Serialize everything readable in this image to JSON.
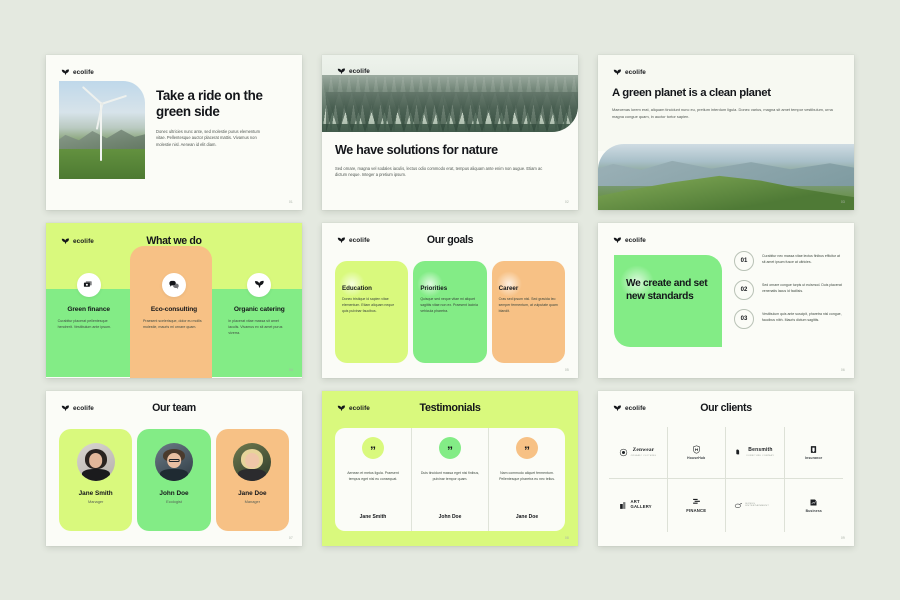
{
  "brand": {
    "name": "ecolife",
    "logo_icon": "leaf-sprout-icon"
  },
  "colors": {
    "background": "#e4e9e0",
    "slide_bg": "#fbfcf7",
    "lime": "#d9f97d",
    "green": "#83ec86",
    "orange": "#f7c185",
    "ink": "#14161a"
  },
  "slides": [
    {
      "id": "take-a-ride",
      "title": "Take a ride on the green side",
      "body": "Donec ultricies nunc ante, sed molestie purus elementum vitae. Pellentesque auctor placerat mattis. Vivamus non molestie nisl. Aenean id elit diam.",
      "image": "wind-turbine-photo",
      "page": "01"
    },
    {
      "id": "solutions-for-nature",
      "title": "We have solutions for nature",
      "body": "Sed ornare, magna vel sodales iaculis, lectus odio commodo erat, tempus aliquam ante enim non augue. Etiam ac dictum neque. Integer a pretium ipsum.",
      "image": "misty-forest-photo",
      "page": "02"
    },
    {
      "id": "green-planet",
      "title": "A green planet is a clean planet",
      "body": "Maecenas lorem erat, aliquam tincidunt nunc eu, pretium interdum ligula. Donec varius, magna sit amet tempor vestibulum, urna magna congue quam, in auctor tortor sapien.",
      "image": "mountain-range-photo",
      "page": "03"
    }
  ],
  "what_we_do": {
    "title": "What we do",
    "page": "04",
    "columns": [
      {
        "icon": "money-stack-icon",
        "heading": "Green finance",
        "body": "Curabitur placerat pellentesque hendrerit. Vestibulum ante ipsum."
      },
      {
        "icon": "chat-bubbles-icon",
        "heading": "Eco-consulting",
        "body": "Praesent scelerisque, dolor eu mollis molestie, mauris mi ornare quam."
      },
      {
        "icon": "sprout-icon",
        "heading": "Organic catering",
        "body": "In placerat vitae massa sit amet iaculis. Vivamus ex sit amet purus viverra."
      }
    ]
  },
  "our_goals": {
    "title": "Our goals",
    "page": "05",
    "cards": [
      {
        "heading": "Education",
        "color": "#d9f97d",
        "body": "Donec tristique id sapien vitae elementum. Etiam aliquam neque quis pulvinar faucibus."
      },
      {
        "heading": "Priorities",
        "color": "#83ec86",
        "body": "Quisque sed neque vitae mi aliquet sagittis vitae non ex. Praesent lacinia vehicula pharetra."
      },
      {
        "heading": "Career",
        "color": "#f7c185",
        "body": "Cras sed ipsum nisl. Sed gravida leo semper fermentum, at vulputate quam blandit."
      }
    ]
  },
  "standards": {
    "title": "We create and set new standards",
    "page": "06",
    "items": [
      {
        "number": "01",
        "body": "Curabitur nec massa vitae lectus finibus efficitur at sit amet ipsum fusce at ultricies."
      },
      {
        "number": "02",
        "body": "Sed ornare congue turpis ut euismod. Duis placerat venenatis lacus id facilisis."
      },
      {
        "number": "03",
        "body": "Vestibulum quis ante suscipit, pharetra nisl congue, faucibus nibh. Mauris dictum sagittis."
      }
    ]
  },
  "our_team": {
    "title": "Our team",
    "page": "07",
    "members": [
      {
        "name": "Jane Smith",
        "role": "Manager",
        "color": "#d9f97d",
        "avatar": "woman-dark-hair-avatar"
      },
      {
        "name": "John Doe",
        "role": "Ecologist",
        "color": "#83ec86",
        "avatar": "man-glasses-avatar"
      },
      {
        "name": "Jane Doe",
        "role": "Manager",
        "color": "#f7c185",
        "avatar": "woman-blonde-avatar"
      }
    ]
  },
  "testimonials": {
    "title": "Testimonials",
    "page": "08",
    "quote_glyph": "”",
    "items": [
      {
        "badge_color": "#d9f97d",
        "quote": "Aenean et metus ligula. Praesent tempus eget nisl eu consequat.",
        "name": "Jane Smith"
      },
      {
        "badge_color": "#83ec86",
        "quote": "Duis tincidunt massa eget nisi finibus, pulvinar tempor quam.",
        "name": "John Doe"
      },
      {
        "badge_color": "#f7c185",
        "quote": "Nam commodo aliquet fermentum. Pellentesque pharetra eu nec tellus.",
        "name": "Jane Doe"
      }
    ]
  },
  "our_clients": {
    "title": "Our clients",
    "page": "09",
    "logos": [
      {
        "name": "Zenwear",
        "sub": "ORGANIC CLOTHING",
        "icon": "circle-emblem-icon",
        "style": "serif"
      },
      {
        "name": "HouseHub",
        "sub": "",
        "icon": "shield-house-icon",
        "style": "stack"
      },
      {
        "name": "Bensmith",
        "sub": "FURNITURE COMPANY",
        "icon": "armchair-icon",
        "style": "inline"
      },
      {
        "name": "Insurance",
        "sub": "",
        "icon": "document-shield-icon",
        "style": "stack"
      },
      {
        "name": "ART GALLERY",
        "sub": "",
        "icon": "frames-icon",
        "style": "inline"
      },
      {
        "name": "FINANCE",
        "sub": "",
        "icon": "bars-icon",
        "style": "stack"
      },
      {
        "name": "BONUS ENTERTAINMENT",
        "sub": "",
        "icon": "ring-icon",
        "style": "inline"
      },
      {
        "name": "Business",
        "sub": "",
        "icon": "chart-arrow-icon",
        "style": "stack"
      }
    ]
  }
}
